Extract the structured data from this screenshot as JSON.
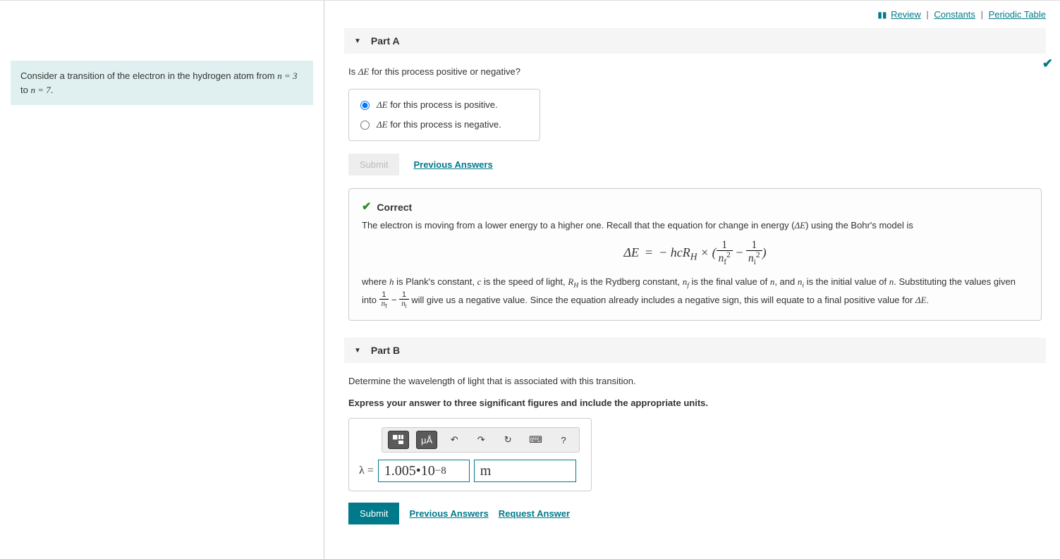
{
  "topLinks": {
    "review": "Review",
    "constants": "Constants",
    "periodic": "Periodic Table"
  },
  "problem": {
    "text_prefix": "Consider a transition of the electron in the hydrogen atom from ",
    "n_from": "n = 3",
    "text_mid": " to ",
    "n_to": "n = 7",
    "text_suffix": "."
  },
  "partA": {
    "title": "Part A",
    "question_prefix": "Is ",
    "question_var": "ΔE",
    "question_suffix": " for this process positive or negative?",
    "option1_prefix": "ΔE",
    "option1_suffix": " for this process is positive.",
    "option2_prefix": "ΔE",
    "option2_suffix": " for this process is negative.",
    "submit": "Submit",
    "prevAnswers": "Previous Answers",
    "feedback": {
      "title": "Correct",
      "line1_a": "The electron is moving from a lower energy to a higher one. Recall that the equation for change in energy (",
      "line1_var": "ΔE",
      "line1_b": ") using the Bohr's model is",
      "eq_lhs": "ΔE",
      "eq_eq": "=",
      "eq_rhs_a": "− hcR",
      "eq_rhs_sub": "H",
      "eq_rhs_b": " × (",
      "eq_frac1_num": "1",
      "eq_frac1_den_a": "n",
      "eq_frac1_den_sub": "f",
      "eq_frac1_den_sup": "2",
      "eq_minus": " − ",
      "eq_frac2_num": "1",
      "eq_frac2_den_a": "n",
      "eq_frac2_den_sub": "i",
      "eq_frac2_den_sup": "2",
      "eq_close": ")",
      "line2_a": "where ",
      "line2_h": "h",
      "line2_b": " is Plank's constant, ",
      "line2_c_var": "c",
      "line2_c": " is the speed of light, ",
      "line2_R": "R",
      "line2_R_sub": "H",
      "line2_d": " is the Rydberg constant, ",
      "line2_nf": "n",
      "line2_nf_sub": "f",
      "line2_e": " is the final value of ",
      "line2_n": "n",
      "line2_f": ", and ",
      "line2_ni": "n",
      "line2_ni_sub": "i",
      "line2_g": " is the initial value of ",
      "line2_h2": ". Substituting the values given into ",
      "line2_frac1_num": "1",
      "line2_frac1_den": "n",
      "line2_frac1_sub": "f",
      "line2_minus": " − ",
      "line2_frac2_num": "1",
      "line2_frac2_den": "n",
      "line2_frac2_sub": "i",
      "line2_i": " will give us a negative value. Since the equation already includes a negative sign, this will equate to a final positive value for ",
      "line2_dE": "ΔE",
      "line2_j": "."
    }
  },
  "partB": {
    "title": "Part B",
    "question": "Determine the wavelength of light that is associated with this transition.",
    "instruction": "Express your answer to three significant figures and include the appropriate units.",
    "toolbar": {
      "units_symbol": "μÅ",
      "undo": "↶",
      "redo": "↷",
      "reset": "↻",
      "keyboard": "⌨",
      "help": "?"
    },
    "lambda_label": "λ =",
    "value_base": "1.005",
    "value_dot": " • ",
    "value_ten": "10",
    "value_exp": "−8",
    "unit": "m",
    "submit": "Submit",
    "prevAnswers": "Previous Answers",
    "requestAnswer": "Request Answer"
  }
}
